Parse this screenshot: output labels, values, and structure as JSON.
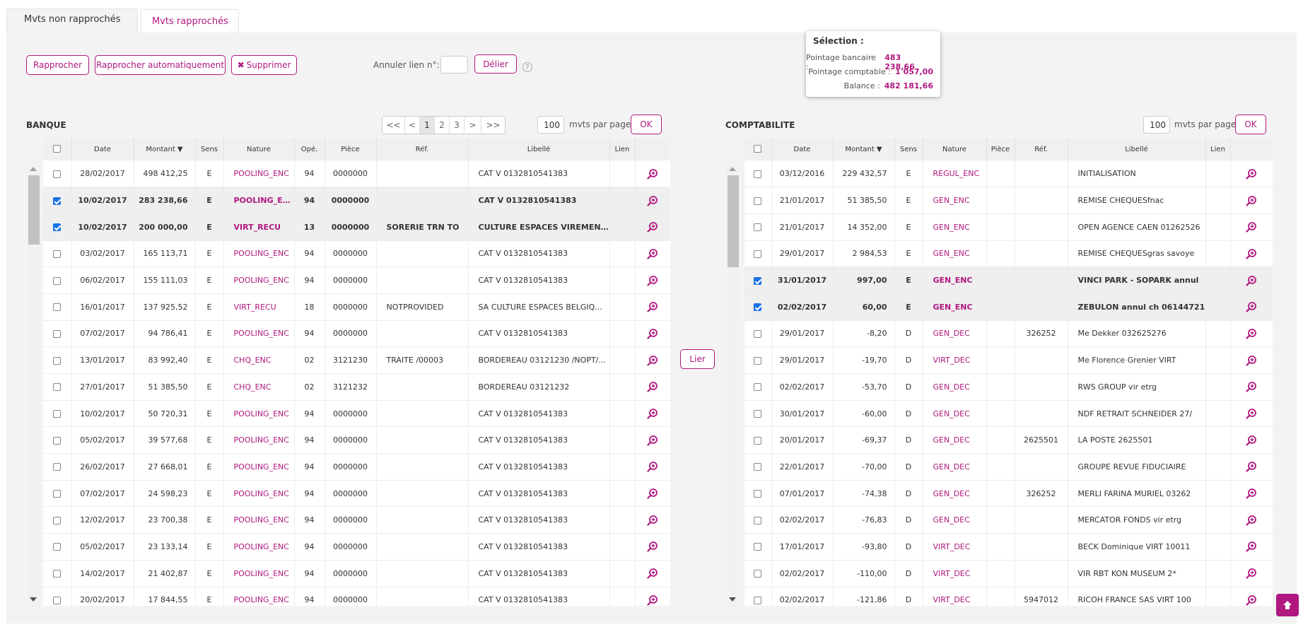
{
  "tabs": [
    {
      "label": "Mvts non rapprochés"
    },
    {
      "label": "Mvts rapprochés"
    }
  ],
  "toolbar": {
    "rapprocher": "Rapprocher",
    "rapprocher_auto": "Rapprocher automatiquement",
    "supprimer": "Supprimer",
    "annuler_label": "Annuler lien n°:",
    "annuler_value": "",
    "delier": "Délier",
    "help": "?"
  },
  "tooltip": {
    "title": "Sélection :",
    "pointage_bancaire_label": "Pointage bancaire :",
    "pointage_bancaire_value": "483 238,66",
    "pointage_comptable_label": "Pointage comptable :",
    "pointage_comptable_value": "1 057,00",
    "balance_label": "Balance :",
    "balance_value": "482 181,66"
  },
  "lier": "Lier",
  "banque": {
    "title": "BANQUE",
    "pager": [
      "<<",
      "<",
      "1",
      "2",
      "3",
      ">",
      ">>"
    ],
    "per_page_value": "100",
    "per_page_label": "mvts par page",
    "ok": "OK",
    "columns": [
      "",
      "Date",
      "Montant ▼",
      "Sens",
      "Nature",
      "Opé.",
      "Pièce",
      "Réf.",
      "Libellé",
      "Lien",
      ""
    ],
    "rows": [
      {
        "checked": false,
        "date": "28/02/2017",
        "montant": "498 412,25",
        "sens": "E",
        "nature": "POOLING_ENC",
        "ope": "94",
        "piece": "0000000",
        "ref": "",
        "libelle": "CAT V 0132810541383",
        "lien": ""
      },
      {
        "checked": true,
        "date": "10/02/2017",
        "montant": "283 238,66",
        "sens": "E",
        "nature": "POOLING_ENC",
        "ope": "94",
        "piece": "0000000",
        "ref": "",
        "libelle": "CAT V 0132810541383",
        "lien": ""
      },
      {
        "checked": true,
        "date": "10/02/2017",
        "montant": "200 000,00",
        "sens": "E",
        "nature": "VIRT_RECU",
        "ope": "13",
        "piece": "0000000",
        "ref": "SORERIE TRN TO",
        "libelle": "CULTURE ESPACES VIREMENT ...",
        "lien": ""
      },
      {
        "checked": false,
        "date": "03/02/2017",
        "montant": "165 113,71",
        "sens": "E",
        "nature": "POOLING_ENC",
        "ope": "94",
        "piece": "0000000",
        "ref": "",
        "libelle": "CAT V 0132810541383",
        "lien": ""
      },
      {
        "checked": false,
        "date": "06/02/2017",
        "montant": "155 111,03",
        "sens": "E",
        "nature": "POOLING_ENC",
        "ope": "94",
        "piece": "0000000",
        "ref": "",
        "libelle": "CAT V 0132810541383",
        "lien": ""
      },
      {
        "checked": false,
        "date": "16/01/2017",
        "montant": "137 925,52",
        "sens": "E",
        "nature": "VIRT_RECU",
        "ope": "18",
        "piece": "0000000",
        "ref": "NOTPROVIDED",
        "libelle": "SA CULTURE ESPACES BELGIQ...",
        "lien": ""
      },
      {
        "checked": false,
        "date": "07/02/2017",
        "montant": "94 786,41",
        "sens": "E",
        "nature": "POOLING_ENC",
        "ope": "94",
        "piece": "0000000",
        "ref": "",
        "libelle": "CAT V 0132810541383",
        "lien": ""
      },
      {
        "checked": false,
        "date": "13/01/2017",
        "montant": "83 992,40",
        "sens": "E",
        "nature": "CHQ_ENC",
        "ope": "02",
        "piece": "3121230",
        "ref": "TRAITE /00003",
        "libelle": "BORDEREAU 03121230 /NOPT/...",
        "lien": ""
      },
      {
        "checked": false,
        "date": "27/01/2017",
        "montant": "51 385,50",
        "sens": "E",
        "nature": "CHQ_ENC",
        "ope": "02",
        "piece": "3121232",
        "ref": "",
        "libelle": "BORDEREAU 03121232",
        "lien": ""
      },
      {
        "checked": false,
        "date": "10/02/2017",
        "montant": "50 720,31",
        "sens": "E",
        "nature": "POOLING_ENC",
        "ope": "94",
        "piece": "0000000",
        "ref": "",
        "libelle": "CAT V 0132810541383",
        "lien": ""
      },
      {
        "checked": false,
        "date": "05/02/2017",
        "montant": "39 577,68",
        "sens": "E",
        "nature": "POOLING_ENC",
        "ope": "94",
        "piece": "0000000",
        "ref": "",
        "libelle": "CAT V 0132810541383",
        "lien": ""
      },
      {
        "checked": false,
        "date": "26/02/2017",
        "montant": "27 668,01",
        "sens": "E",
        "nature": "POOLING_ENC",
        "ope": "94",
        "piece": "0000000",
        "ref": "",
        "libelle": "CAT V 0132810541383",
        "lien": ""
      },
      {
        "checked": false,
        "date": "07/02/2017",
        "montant": "24 598,23",
        "sens": "E",
        "nature": "POOLING_ENC",
        "ope": "94",
        "piece": "0000000",
        "ref": "",
        "libelle": "CAT V 0132810541383",
        "lien": ""
      },
      {
        "checked": false,
        "date": "12/02/2017",
        "montant": "23 700,38",
        "sens": "E",
        "nature": "POOLING_ENC",
        "ope": "94",
        "piece": "0000000",
        "ref": "",
        "libelle": "CAT V 0132810541383",
        "lien": ""
      },
      {
        "checked": false,
        "date": "05/02/2017",
        "montant": "23 133,14",
        "sens": "E",
        "nature": "POOLING_ENC",
        "ope": "94",
        "piece": "0000000",
        "ref": "",
        "libelle": "CAT V 0132810541383",
        "lien": ""
      },
      {
        "checked": false,
        "date": "14/02/2017",
        "montant": "21 402,87",
        "sens": "E",
        "nature": "POOLING_ENC",
        "ope": "94",
        "piece": "0000000",
        "ref": "",
        "libelle": "CAT V 0132810541383",
        "lien": ""
      },
      {
        "checked": false,
        "date": "20/02/2017",
        "montant": "17 844,55",
        "sens": "E",
        "nature": "POOLING_ENC",
        "ope": "94",
        "piece": "0000000",
        "ref": "",
        "libelle": "CAT V 0132810541383",
        "lien": ""
      }
    ]
  },
  "comptabilite": {
    "title": "COMPTABILITE",
    "per_page_value": "100",
    "per_page_label": "mvts par page",
    "ok": "OK",
    "columns": [
      "",
      "Date",
      "Montant ▼",
      "Sens",
      "Nature",
      "Pièce",
      "Réf.",
      "Libellé",
      "Lien",
      ""
    ],
    "rows": [
      {
        "checked": false,
        "date": "03/12/2016",
        "montant": "229 432,57",
        "sens": "E",
        "nature": "REGUL_ENC",
        "piece": "",
        "ref": "",
        "libelle": "INITIALISATION",
        "lien": ""
      },
      {
        "checked": false,
        "date": "21/01/2017",
        "montant": "51 385,50",
        "sens": "E",
        "nature": "GEN_ENC",
        "piece": "",
        "ref": "",
        "libelle": "REMISE CHEQUESfnac",
        "lien": ""
      },
      {
        "checked": false,
        "date": "21/01/2017",
        "montant": "14 352,00",
        "sens": "E",
        "nature": "GEN_ENC",
        "piece": "",
        "ref": "",
        "libelle": "OPEN AGENCE CAEN 01262526",
        "lien": ""
      },
      {
        "checked": false,
        "date": "29/01/2017",
        "montant": "2 984,53",
        "sens": "E",
        "nature": "GEN_ENC",
        "piece": "",
        "ref": "",
        "libelle": "REMISE CHEQUESgras savoye",
        "lien": ""
      },
      {
        "checked": true,
        "date": "31/01/2017",
        "montant": "997,00",
        "sens": "E",
        "nature": "GEN_ENC",
        "piece": "",
        "ref": "",
        "libelle": "VINCI PARK - SOPARK annul",
        "lien": ""
      },
      {
        "checked": true,
        "date": "02/02/2017",
        "montant": "60,00",
        "sens": "E",
        "nature": "GEN_ENC",
        "piece": "",
        "ref": "",
        "libelle": "ZEBULON annul ch 06144721",
        "lien": ""
      },
      {
        "checked": false,
        "date": "29/01/2017",
        "montant": "-8,20",
        "sens": "D",
        "nature": "GEN_DEC",
        "piece": "",
        "ref": "326252",
        "libelle": "Me Dekker 032625276",
        "lien": ""
      },
      {
        "checked": false,
        "date": "29/01/2017",
        "montant": "-19,70",
        "sens": "D",
        "nature": "VIRT_DEC",
        "piece": "",
        "ref": "",
        "libelle": "Me Florence Grenier VIRT",
        "lien": ""
      },
      {
        "checked": false,
        "date": "02/02/2017",
        "montant": "-53,70",
        "sens": "D",
        "nature": "GEN_DEC",
        "piece": "",
        "ref": "",
        "libelle": "RWS GROUP vir etrg",
        "lien": ""
      },
      {
        "checked": false,
        "date": "30/01/2017",
        "montant": "-60,00",
        "sens": "D",
        "nature": "GEN_DEC",
        "piece": "",
        "ref": "",
        "libelle": "NDF RETRAIT SCHNEIDER 27/",
        "lien": ""
      },
      {
        "checked": false,
        "date": "20/01/2017",
        "montant": "-69,37",
        "sens": "D",
        "nature": "GEN_DEC",
        "piece": "",
        "ref": "2625501",
        "libelle": "LA POSTE 2625501",
        "lien": ""
      },
      {
        "checked": false,
        "date": "22/01/2017",
        "montant": "-70,00",
        "sens": "D",
        "nature": "GEN_DEC",
        "piece": "",
        "ref": "",
        "libelle": "GROUPE REVUE FIDUCIAIRE",
        "lien": ""
      },
      {
        "checked": false,
        "date": "07/01/2017",
        "montant": "-74,38",
        "sens": "D",
        "nature": "GEN_DEC",
        "piece": "",
        "ref": "326252",
        "libelle": "MERLI FARINA MURIEL 03262",
        "lien": ""
      },
      {
        "checked": false,
        "date": "02/02/2017",
        "montant": "-76,83",
        "sens": "D",
        "nature": "GEN_DEC",
        "piece": "",
        "ref": "",
        "libelle": "MERCATOR FONDS vir etrg",
        "lien": ""
      },
      {
        "checked": false,
        "date": "17/01/2017",
        "montant": "-93,80",
        "sens": "D",
        "nature": "VIRT_DEC",
        "piece": "",
        "ref": "",
        "libelle": "BECK Dominique VIRT 10011",
        "lien": ""
      },
      {
        "checked": false,
        "date": "02/02/2017",
        "montant": "-110,00",
        "sens": "D",
        "nature": "VIRT_DEC",
        "piece": "",
        "ref": "",
        "libelle": "VIR RBT KON MUSEUM 2*",
        "lien": ""
      },
      {
        "checked": false,
        "date": "02/02/2017",
        "montant": "-121,86",
        "sens": "D",
        "nature": "VIRT_DEC",
        "piece": "",
        "ref": "5947012",
        "libelle": "RICOH FRANCE SAS VIRT 100",
        "lien": ""
      }
    ]
  },
  "colors": {
    "accent": "#b0177f",
    "checkbox": "#1a73e8",
    "panel_bg": "#f3f3f3"
  }
}
